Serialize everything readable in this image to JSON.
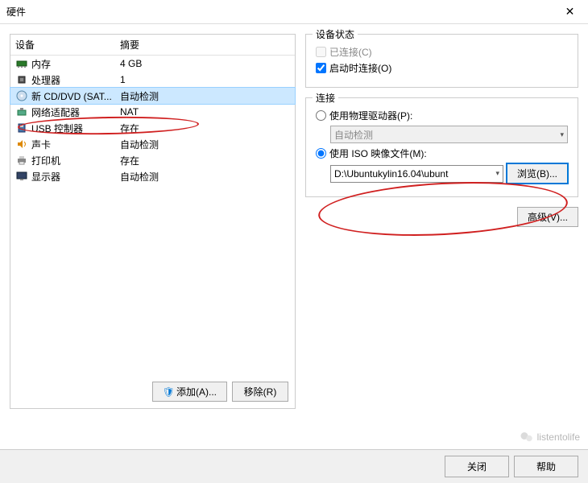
{
  "window": {
    "title": "硬件"
  },
  "hardware": {
    "header_device": "设备",
    "header_summary": "摘要",
    "rows": [
      {
        "name": "内存",
        "summary": "4 GB",
        "icon": "memory"
      },
      {
        "name": "处理器",
        "summary": "1",
        "icon": "cpu"
      },
      {
        "name": "新 CD/DVD (SAT...",
        "summary": "自动检测",
        "icon": "cd",
        "selected": true
      },
      {
        "name": "网络适配器",
        "summary": "NAT",
        "icon": "network"
      },
      {
        "name": "USB 控制器",
        "summary": "存在",
        "icon": "usb"
      },
      {
        "name": "声卡",
        "summary": "自动检测",
        "icon": "sound"
      },
      {
        "name": "打印机",
        "summary": "存在",
        "icon": "printer"
      },
      {
        "name": "显示器",
        "summary": "自动检测",
        "icon": "display"
      }
    ],
    "add_btn": "添加(A)...",
    "remove_btn": "移除(R)"
  },
  "device_status": {
    "title": "设备状态",
    "connected": "已连接(C)",
    "connect_on_start": "启动时连接(O)"
  },
  "connection": {
    "title": "连接",
    "use_physical": "使用物理驱动器(P):",
    "physical_value": "自动检测",
    "use_iso": "使用 ISO 映像文件(M):",
    "iso_path": "D:\\Ubuntukylin16.04\\ubunt",
    "browse_btn": "浏览(B)...",
    "advanced_btn": "高级(V)..."
  },
  "footer": {
    "close_btn": "关闭",
    "help_btn": "帮助"
  },
  "watermark": {
    "text": "listentolife"
  }
}
